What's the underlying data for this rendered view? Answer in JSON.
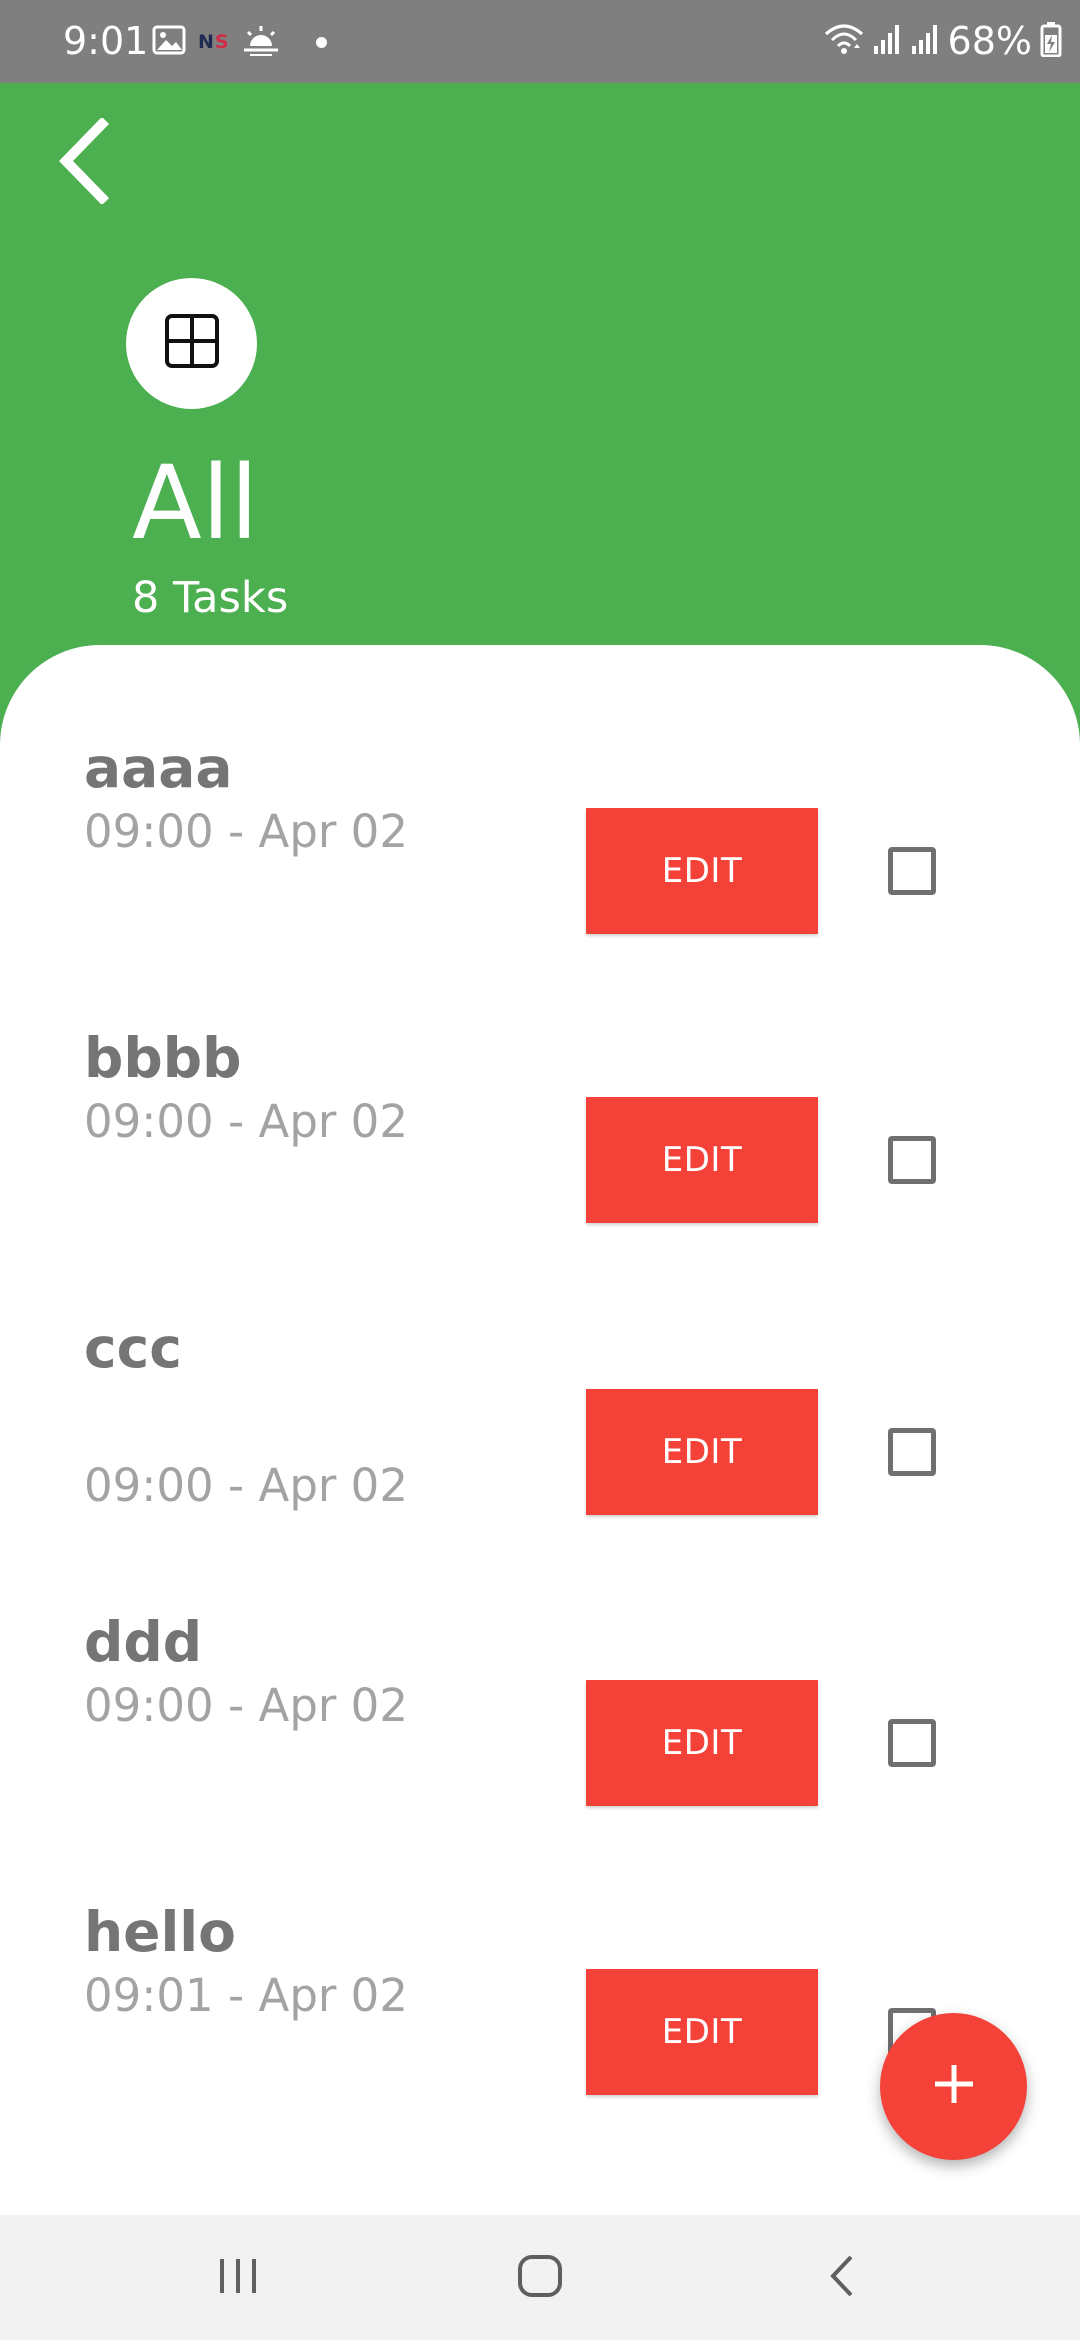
{
  "status_bar": {
    "time": "9:01",
    "battery": "68%",
    "left_icons": [
      "gallery-icon",
      "ns-badge-icon",
      "weather-sunrise-icon",
      "notification-dot"
    ],
    "right_icons": [
      "wifi-icon",
      "signal-icon",
      "signal-icon",
      "battery-charging-icon"
    ],
    "ns_badge": {
      "n": "N",
      "s": "S"
    }
  },
  "header": {
    "back_icon": "chevron-left-icon",
    "category_icon": "grid-icon",
    "title": "All",
    "task_count": "8 Tasks",
    "background_color": "#4caf50"
  },
  "tasks": [
    {
      "title": "aaaa",
      "time": "09:00 - Apr 02",
      "edit_label": "EDIT",
      "checked": false
    },
    {
      "title": "bbbb",
      "time": "09:00 - Apr 02",
      "edit_label": "EDIT",
      "checked": false
    },
    {
      "title": "ccc",
      "time": "09:00 - Apr 02",
      "edit_label": "EDIT",
      "checked": false
    },
    {
      "title": "ddd",
      "time": "09:00 - Apr 02",
      "edit_label": "EDIT",
      "checked": false
    },
    {
      "title": "hello",
      "time": "09:01 - Apr 02",
      "edit_label": "EDIT",
      "checked": false
    }
  ],
  "fab": {
    "icon": "plus-icon",
    "color": "#f44238"
  },
  "nav_bar": {
    "items": [
      "recent-apps-icon",
      "home-icon",
      "back-icon"
    ]
  },
  "colors": {
    "accent": "#f44238",
    "primary": "#4caf50",
    "title_text": "#757575",
    "time_text": "#a3a3a3"
  }
}
